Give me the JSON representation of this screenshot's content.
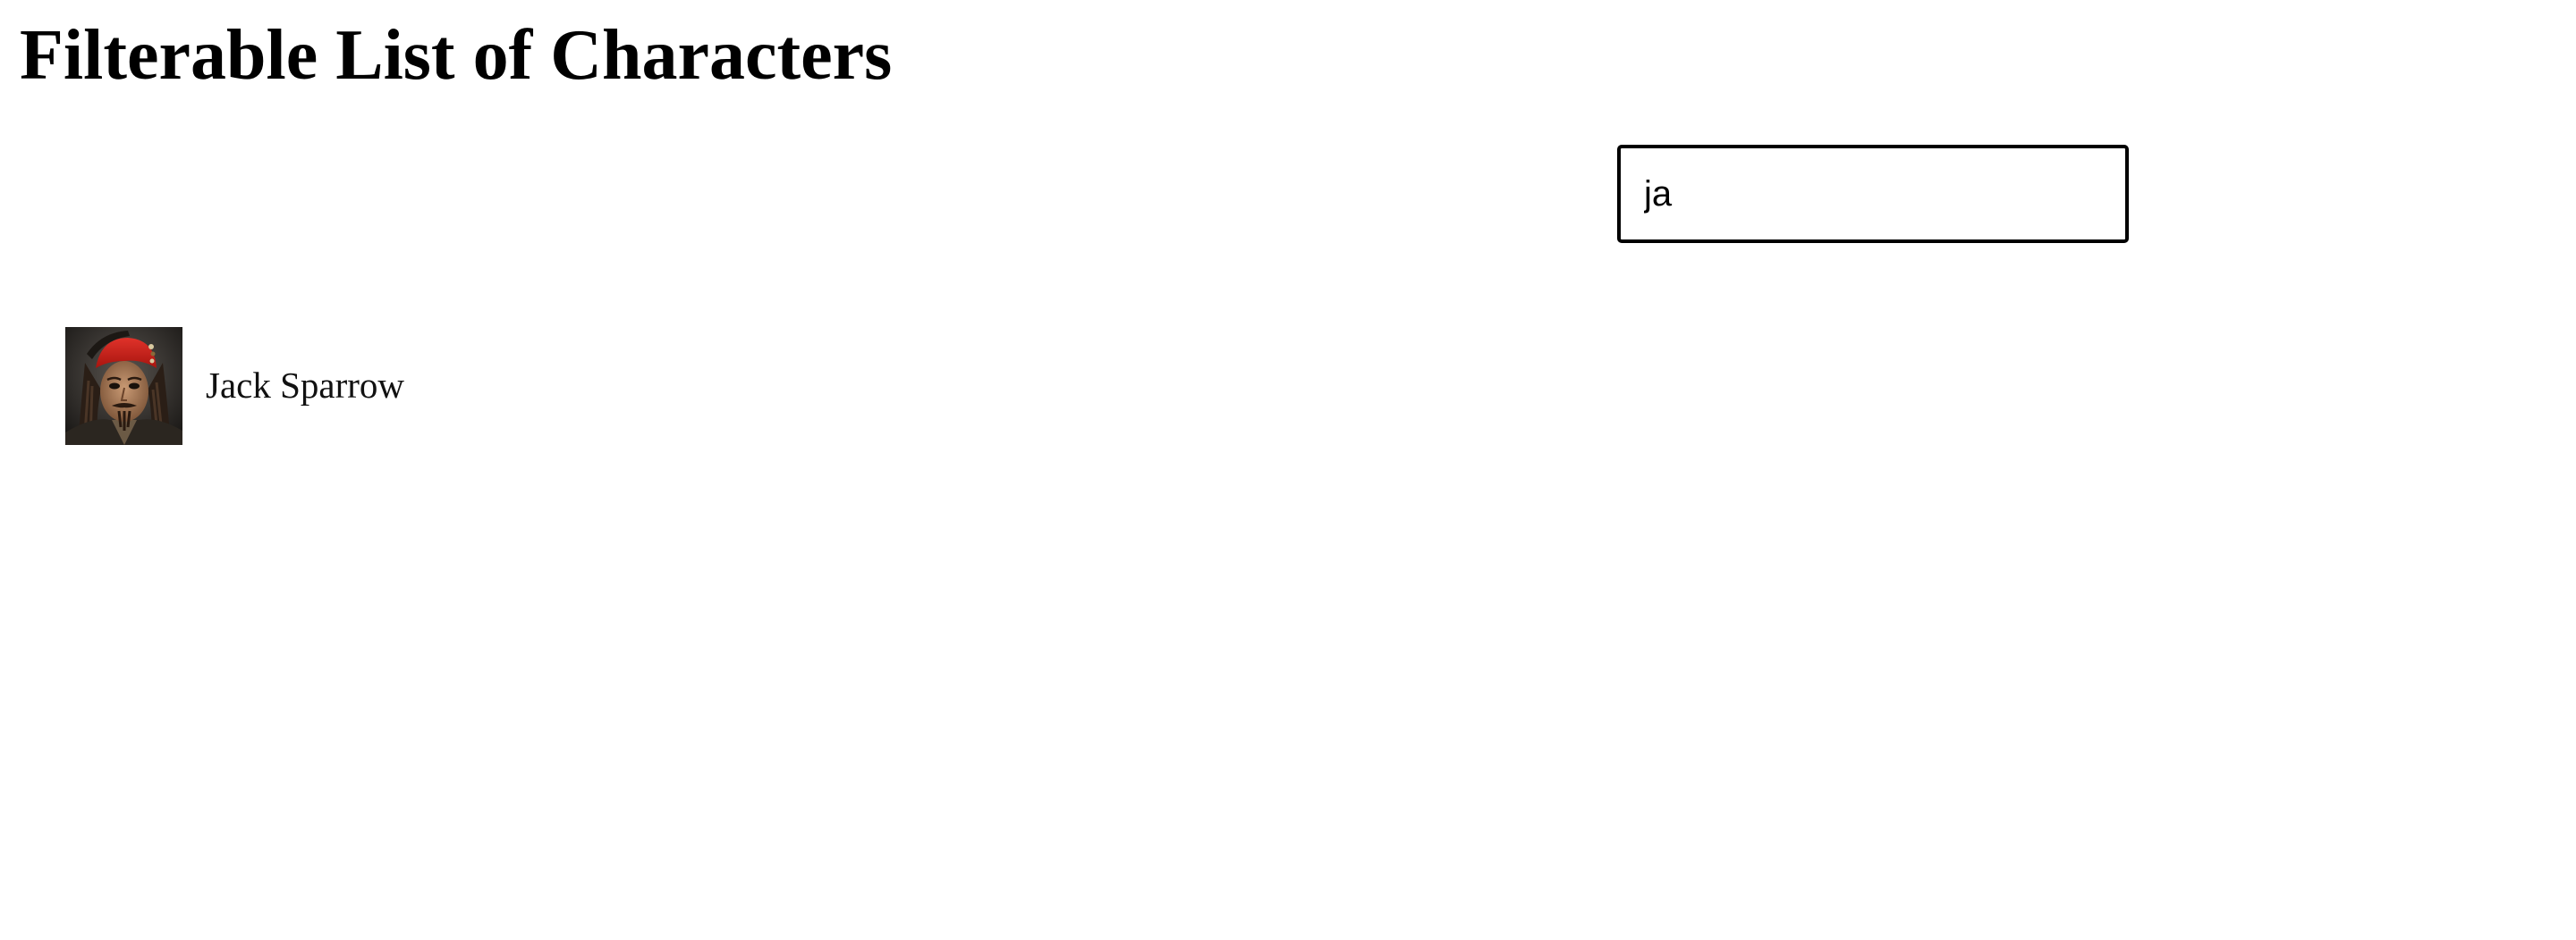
{
  "page": {
    "title": "Filterable List of Characters"
  },
  "search": {
    "value": "ja"
  },
  "characters": [
    {
      "name": "Jack Sparrow",
      "avatar_icon": "jack-sparrow-portrait"
    }
  ]
}
